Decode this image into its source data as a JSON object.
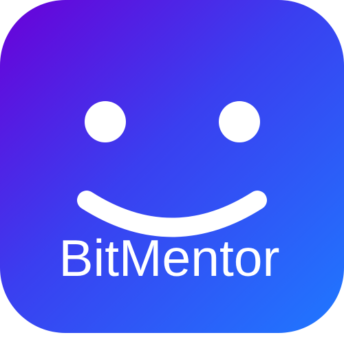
{
  "app_icon": {
    "name": "BitMentor",
    "gradient_start": "#6a00d8",
    "gradient_mid": "#3a3ff0",
    "gradient_end": "#1f78ff",
    "face_color": "#ffffff",
    "icon": "smiley-face-icon"
  }
}
